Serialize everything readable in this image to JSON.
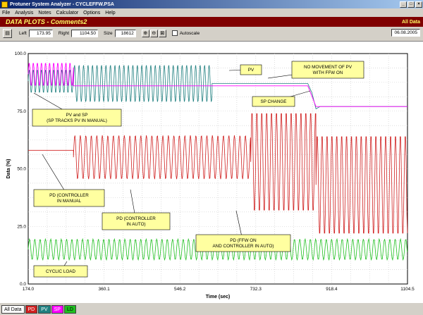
{
  "window": {
    "title": "Protuner System Analyzer - CYCLEFFW.PSA"
  },
  "menu": [
    "File",
    "Analysis",
    "Notes",
    "Calculator",
    "Options",
    "Help"
  ],
  "banner": {
    "title": "DATA PLOTS - Comments2",
    "right": "All Data"
  },
  "toolbar": {
    "left_label": "Left",
    "left_value": "173.95",
    "right_label": "Right",
    "right_value": "1104.50",
    "size_label": "Size",
    "size_value": "18612",
    "autoscale_label": "Autoscale",
    "date": "06.08.2005"
  },
  "chart_data": {
    "type": "line",
    "ylabel": "Data (%)",
    "xlabel": "Time (sec)",
    "xlim": [
      174.0,
      1104.5
    ],
    "ylim": [
      0,
      100
    ],
    "x_ticks": [
      "174.0",
      "360.1",
      "546.2",
      "732.3",
      "918.4",
      "1104.5"
    ],
    "y_ticks": [
      "0.0",
      "25.0",
      "50.0",
      "75.0",
      "100.0"
    ],
    "grid": true,
    "series": [
      {
        "name": "PD",
        "color": "#d02020"
      },
      {
        "name": "PV",
        "color": "#208080"
      },
      {
        "name": "SP",
        "color": "#ff00ff"
      },
      {
        "name": "LD",
        "color": "#20c020"
      }
    ],
    "annotations": [
      "PV",
      "NO MOVEMENT OF PV\nWITH FFW ON",
      "SP CHANGE",
      "PV and SP\n(SP TRACKS PV IN MANUAL)",
      "PD (CONTROLLER\nIN MANUAL",
      "PD (CONTROLLER\nIN AUTO)",
      "PD (FFW ON\nAND CONTROLLER IN AUTO)",
      "CYCLIC LOAD"
    ]
  },
  "status_tabs": [
    "All Data",
    "PD",
    "PV",
    "SP",
    "LD"
  ]
}
